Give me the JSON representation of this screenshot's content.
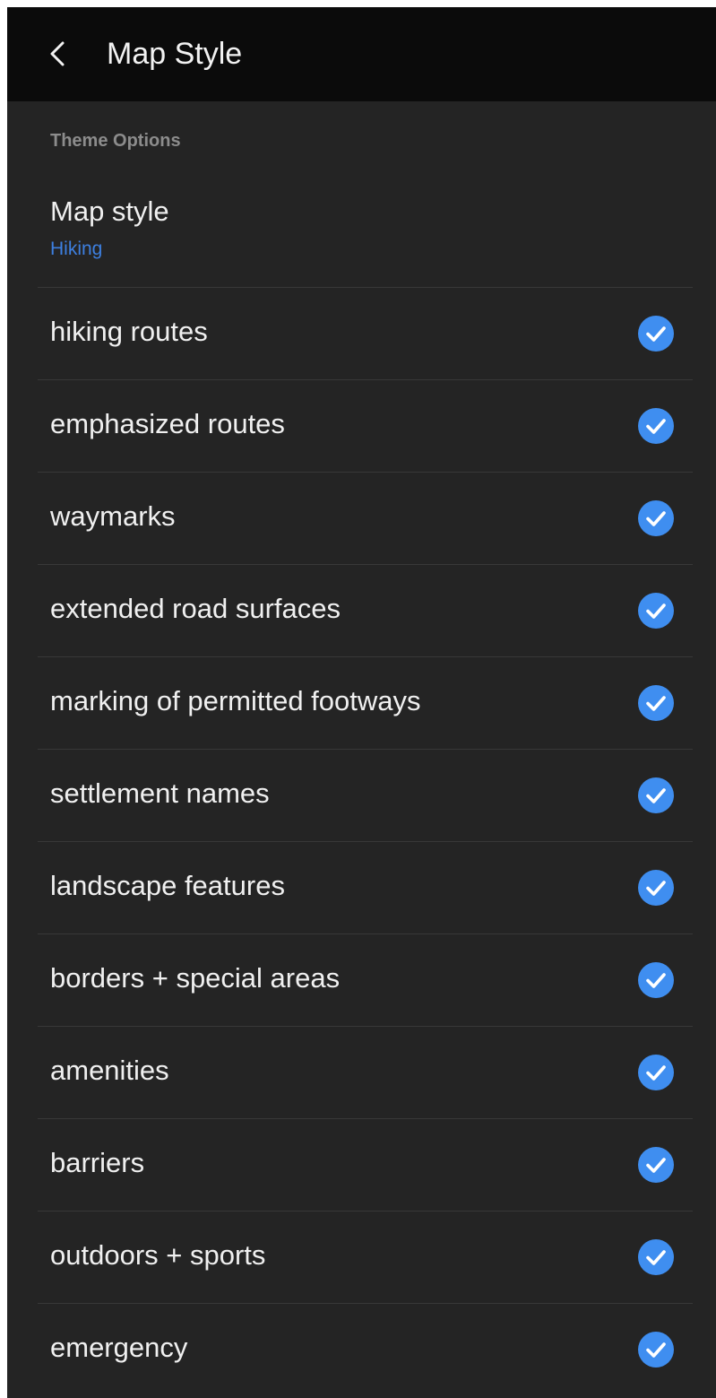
{
  "app_bar": {
    "title": "Map Style",
    "back_icon": "chevron-left-icon"
  },
  "section": {
    "header": "Theme Options"
  },
  "map_style": {
    "label": "Map style",
    "value": "Hiking"
  },
  "colors": {
    "accent": "#3d7fe0",
    "check": "#3f8ef0",
    "background": "#242424",
    "app_bar": "#0b0b0b"
  },
  "options": [
    {
      "label": "hiking routes",
      "checked": true,
      "icon": "check-circle-icon"
    },
    {
      "label": "emphasized routes",
      "checked": true,
      "icon": "check-circle-icon"
    },
    {
      "label": "waymarks",
      "checked": true,
      "icon": "check-circle-icon"
    },
    {
      "label": "extended road surfaces",
      "checked": true,
      "icon": "check-circle-icon"
    },
    {
      "label": "marking of permitted footways",
      "checked": true,
      "icon": "check-circle-icon"
    },
    {
      "label": "settlement names",
      "checked": true,
      "icon": "check-circle-icon"
    },
    {
      "label": "landscape features",
      "checked": true,
      "icon": "check-circle-icon"
    },
    {
      "label": "borders + special areas",
      "checked": true,
      "icon": "check-circle-icon"
    },
    {
      "label": "amenities",
      "checked": true,
      "icon": "check-circle-icon"
    },
    {
      "label": "barriers",
      "checked": true,
      "icon": "check-circle-icon"
    },
    {
      "label": "outdoors + sports",
      "checked": true,
      "icon": "check-circle-icon"
    },
    {
      "label": "emergency",
      "checked": true,
      "icon": "check-circle-icon"
    }
  ]
}
